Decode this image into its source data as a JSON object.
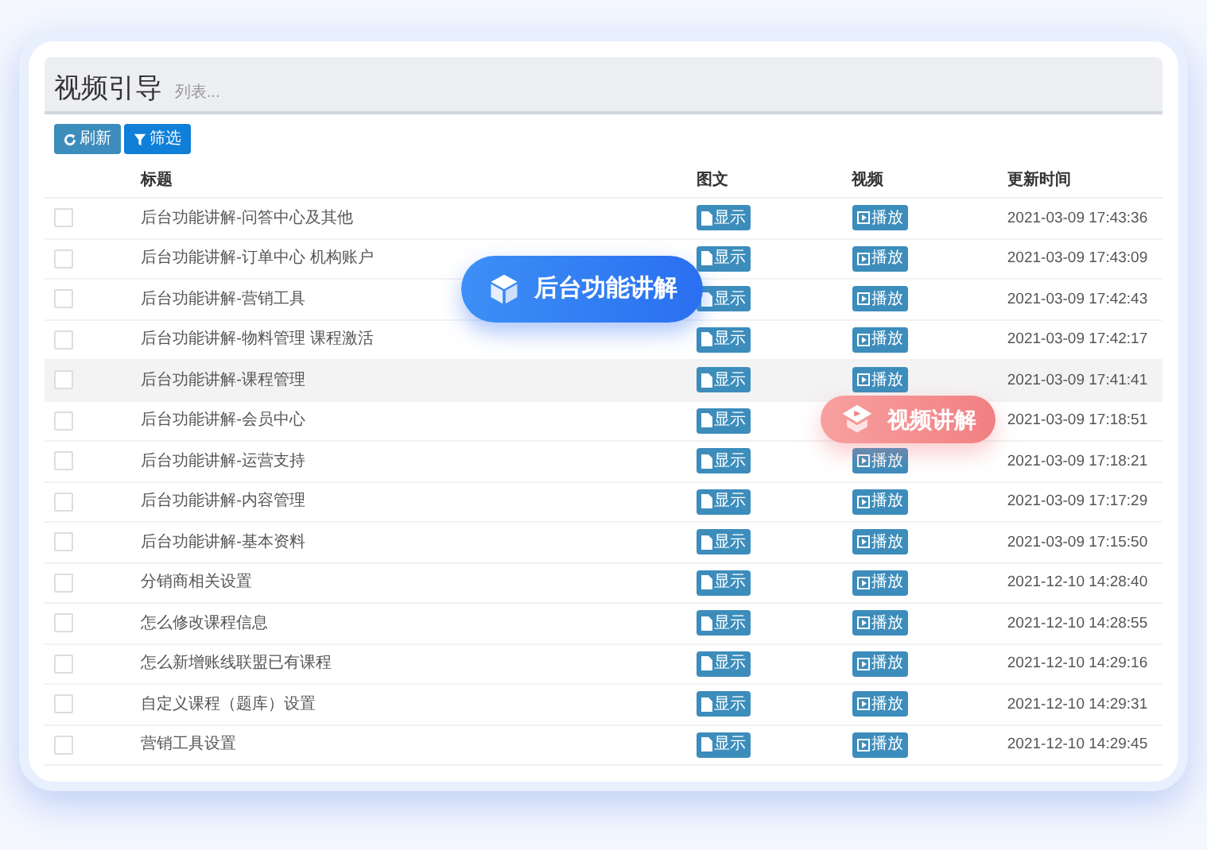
{
  "header": {
    "title": "视频引导",
    "subtitle": "列表..."
  },
  "toolbar": [
    {
      "kind": "refresh",
      "label": "刷新"
    },
    {
      "kind": "filter",
      "label": "筛选"
    }
  ],
  "table": {
    "columns": [
      "标题",
      "图文",
      "视频",
      "更新时间"
    ],
    "rows": [
      {
        "title": "后台功能讲解-问答中心及其他",
        "doc": "显示",
        "play": "播放",
        "updated": "2021-03-09 17:43:36",
        "checked": false,
        "selected": false
      },
      {
        "title": "后台功能讲解-订单中心 机构账户",
        "doc": "显示",
        "play": "播放",
        "updated": "2021-03-09 17:43:09",
        "checked": false,
        "selected": false
      },
      {
        "title": "后台功能讲解-营销工具",
        "doc": "显示",
        "play": "播放",
        "updated": "2021-03-09 17:42:43",
        "checked": false,
        "selected": false
      },
      {
        "title": "后台功能讲解-物料管理 课程激活",
        "doc": "显示",
        "play": "播放",
        "updated": "2021-03-09 17:42:17",
        "checked": false,
        "selected": false
      },
      {
        "title": "后台功能讲解-课程管理",
        "doc": "显示",
        "play": "播放",
        "updated": "2021-03-09 17:41:41",
        "checked": false,
        "selected": true
      },
      {
        "title": "后台功能讲解-会员中心",
        "doc": "显示",
        "updated": "2021-03-09 17:18:51",
        "checked": false,
        "selected": false
      },
      {
        "title": "后台功能讲解-运营支持",
        "doc": "显示",
        "play": "播放",
        "updated": "2021-03-09 17:18:21",
        "checked": false,
        "selected": false
      },
      {
        "title": "后台功能讲解-内容管理",
        "doc": "显示",
        "play": "播放",
        "updated": "2021-03-09 17:17:29",
        "checked": false,
        "selected": false
      },
      {
        "title": "后台功能讲解-基本资料",
        "doc": "显示",
        "play": "播放",
        "updated": "2021-03-09 17:15:50",
        "checked": false,
        "selected": false
      },
      {
        "title": "分销商相关设置",
        "doc": "显示",
        "play": "播放",
        "updated": "2021-12-10 14:28:40",
        "checked": false,
        "selected": false
      },
      {
        "title": "怎么修改课程信息",
        "doc": "显示",
        "play": "播放",
        "updated": "2021-12-10 14:28:55",
        "checked": false,
        "selected": false
      },
      {
        "title": "怎么新增账线联盟已有课程",
        "doc": "显示",
        "play": "播放",
        "updated": "2021-12-10 14:29:16",
        "checked": false,
        "selected": false
      },
      {
        "title": "自定义课程（题库）设置",
        "doc": "显示",
        "play": "播放",
        "updated": "2021-12-10 14:29:31",
        "checked": false,
        "selected": false
      },
      {
        "title": "营销工具设置",
        "doc": "显示",
        "play": "播放",
        "updated": "2021-12-10 14:29:45",
        "checked": false,
        "selected": false
      }
    ]
  },
  "badges": [
    {
      "kind": "backend",
      "label": "后台功能讲解"
    },
    {
      "kind": "video",
      "label": "视频讲解"
    }
  ]
}
